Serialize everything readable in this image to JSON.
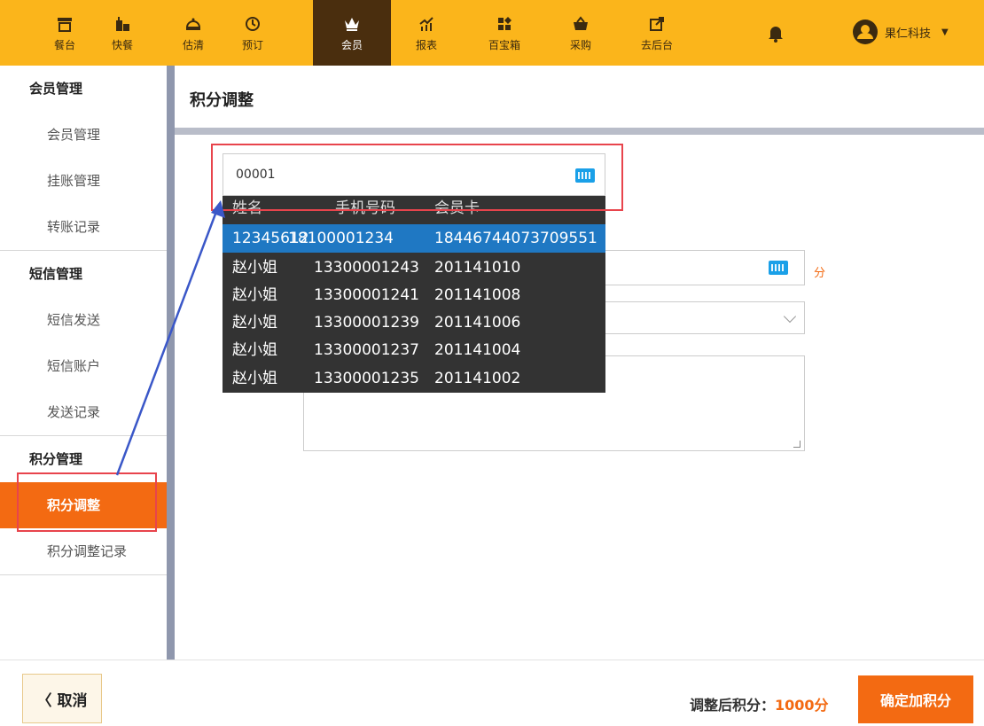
{
  "nav": {
    "items": [
      {
        "label": "餐台",
        "icon": "table-icon"
      },
      {
        "label": "快餐",
        "icon": "fastfood-icon"
      },
      {
        "label": "估清",
        "icon": "cloche-icon"
      },
      {
        "label": "预订",
        "icon": "clock-icon"
      },
      {
        "label": "会员",
        "icon": "crown-icon"
      },
      {
        "label": "报表",
        "icon": "chart-icon"
      },
      {
        "label": "百宝箱",
        "icon": "grid-icon"
      },
      {
        "label": "采购",
        "icon": "basket-icon"
      },
      {
        "label": "去后台",
        "icon": "external-link-icon"
      }
    ],
    "active": "会员",
    "user_name": "果仁科技"
  },
  "sidebar": {
    "groups": [
      {
        "title": "会员管理",
        "items": [
          "会员管理",
          "挂账管理",
          "转账记录"
        ]
      },
      {
        "title": "短信管理",
        "items": [
          "短信发送",
          "短信账户",
          "发送记录"
        ]
      },
      {
        "title": "积分管理",
        "items": [
          "积分调整",
          "积分调整记录"
        ]
      }
    ],
    "active_item": "积分调整"
  },
  "main": {
    "title": "积分调整",
    "search_value": "00001",
    "points_unit": "分"
  },
  "dropdown": {
    "headers": [
      "姓名",
      "手机号码",
      "会员卡"
    ],
    "rows": [
      [
        "12345612",
        "18100001234",
        "18446744073709551"
      ],
      [
        "赵小姐",
        "13300001243",
        "201141010"
      ],
      [
        "赵小姐",
        "13300001241",
        "201141008"
      ],
      [
        "赵小姐",
        "13300001239",
        "201141006"
      ],
      [
        "赵小姐",
        "13300001237",
        "201141004"
      ],
      [
        "赵小姐",
        "13300001235",
        "201141002"
      ]
    ]
  },
  "footer": {
    "cancel_label": "〈 取消",
    "after_label": "调整后积分：",
    "after_value": "1000分",
    "confirm_label": "确定加积分"
  },
  "colors": {
    "brand": "#fbb51b",
    "accent": "#f36a12",
    "active_nav": "#4a2e0e",
    "highlight": "#1f78c3",
    "annotation": "#e8444c"
  }
}
